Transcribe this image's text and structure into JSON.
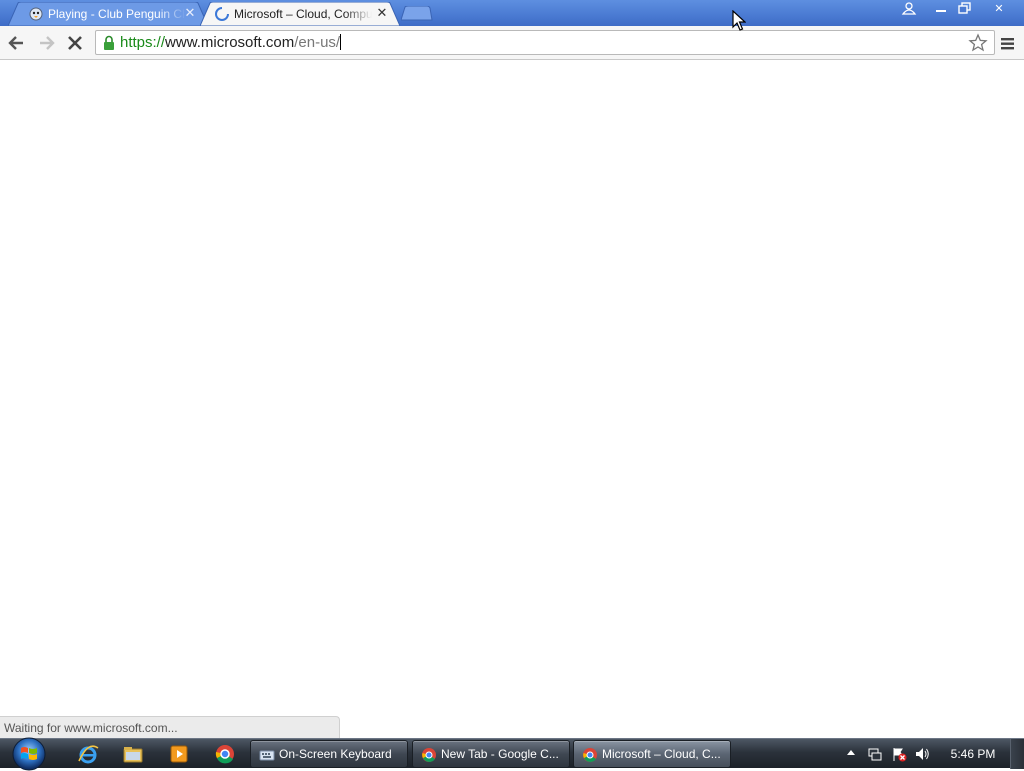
{
  "browser": {
    "tabs": [
      {
        "title": "Playing - Club Penguin Cl",
        "icon": "club-penguin-icon",
        "active": false,
        "close": "✕"
      },
      {
        "title": "Microsoft – Cloud, Compu",
        "icon": "loading-spinner-icon",
        "active": true,
        "close": "✕"
      }
    ],
    "window_controls": {
      "user": "user-icon",
      "minimize": "minimize-icon",
      "restore": "restore-icon",
      "close": "✕"
    },
    "toolbar": {
      "url_scheme": "https://",
      "url_host": "www.microsoft.com",
      "url_path": "/en-us/",
      "secure": true
    },
    "status_text": "Waiting for www.microsoft.com..."
  },
  "taskbar": {
    "quick_launch": [
      "internet-explorer-icon",
      "windows-explorer-icon",
      "media-player-icon",
      "chrome-icon"
    ],
    "items": [
      {
        "label": "On-Screen Keyboard",
        "icon": "keyboard-icon",
        "active": false
      },
      {
        "label": "New Tab - Google C...",
        "icon": "chrome-icon",
        "active": false
      },
      {
        "label": "Microsoft – Cloud, C...",
        "icon": "chrome-icon",
        "active": true
      }
    ],
    "clock": "5:46 PM"
  },
  "colors": {
    "titlebar": "#4a7ad2",
    "secure_scheme": "#1a8a1a",
    "taskbar": "#2b323b"
  }
}
